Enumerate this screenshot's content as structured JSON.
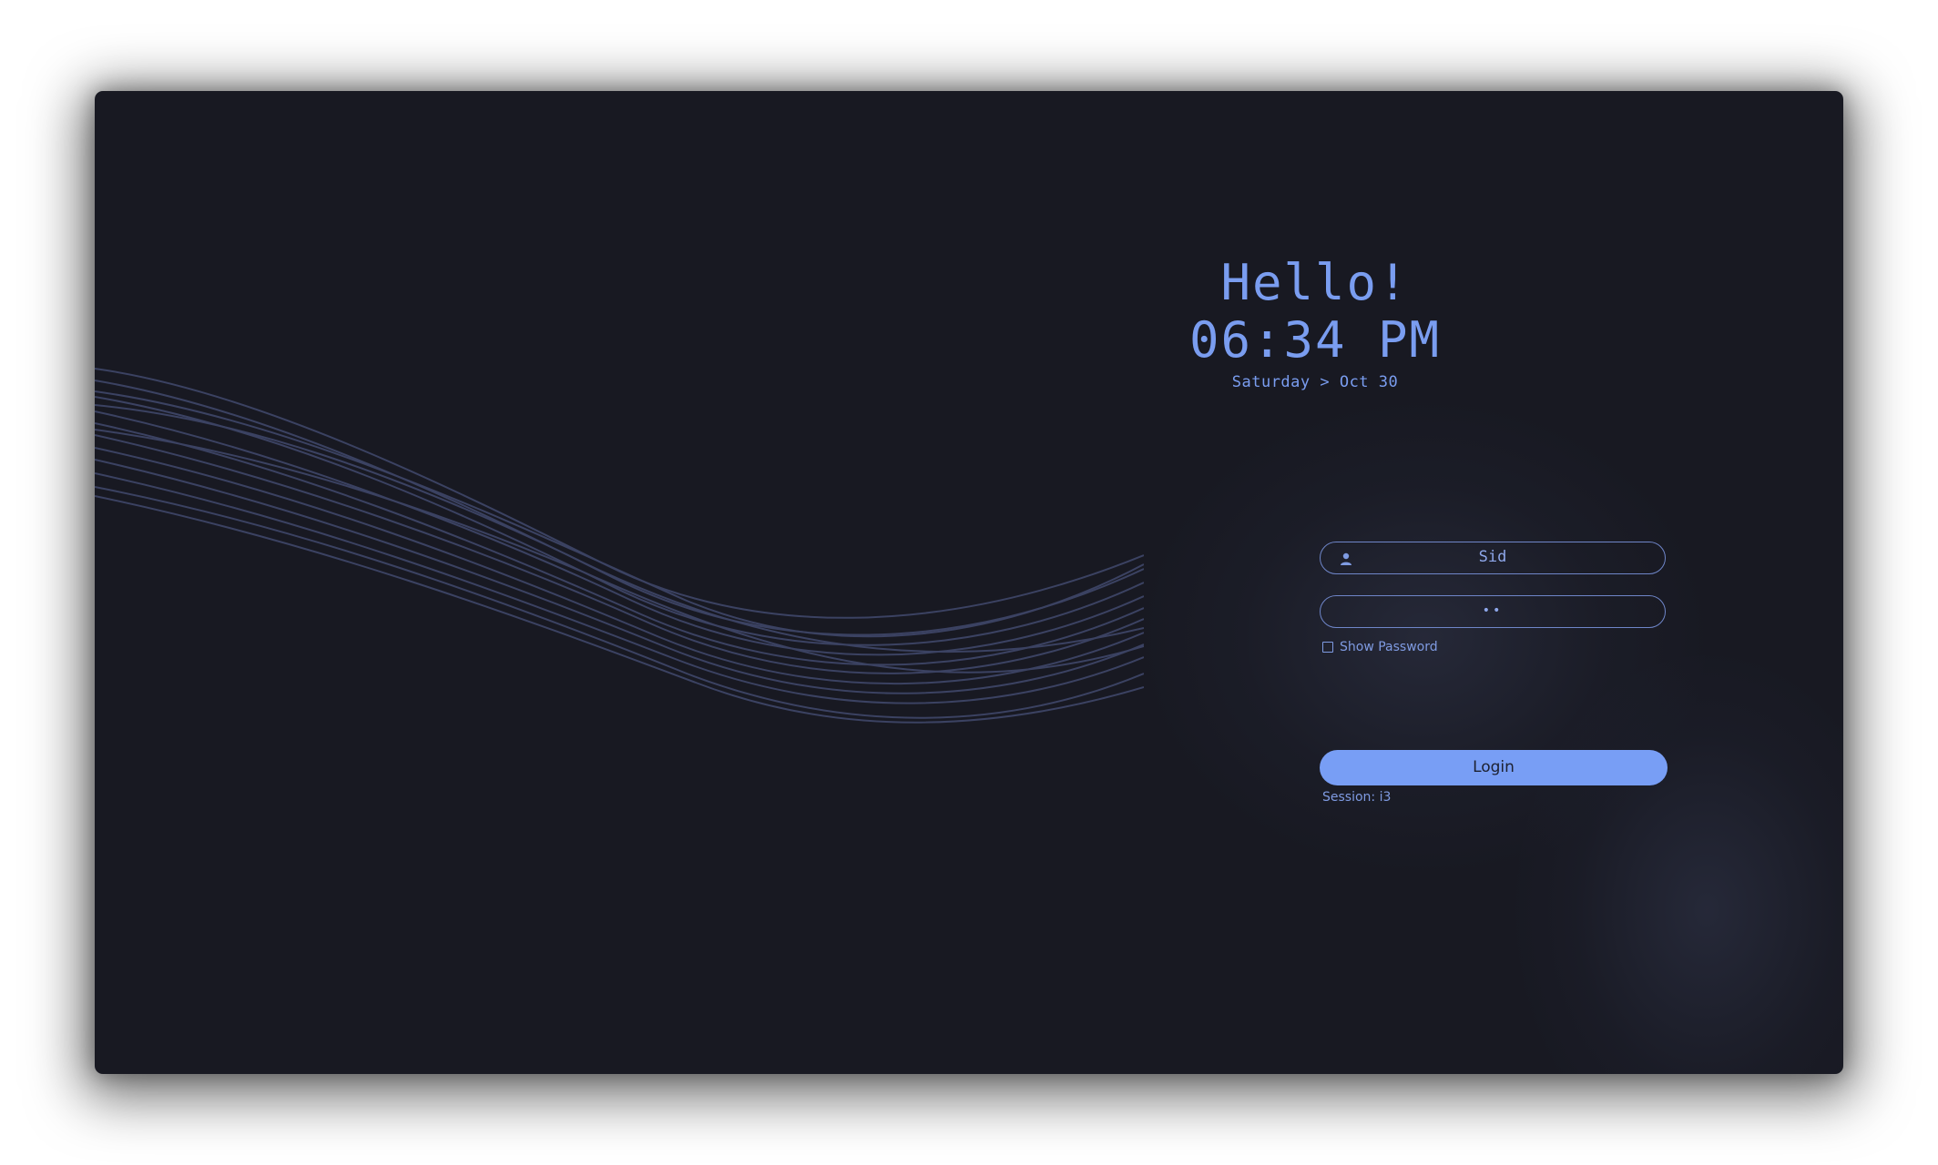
{
  "greeting": {
    "hello": "Hello!",
    "time": "06:34 PM",
    "date": "Saturday > Oct 30"
  },
  "form": {
    "username": "Sid",
    "password_mask": "••",
    "show_password_label": "Show Password",
    "login_label": "Login",
    "session_label": "Session: i3"
  },
  "icons": {
    "username_icon": "user-icon"
  },
  "colors": {
    "background": "#181922",
    "accent": "#789ef5",
    "text": "#7a9df0",
    "wave_lines": "#3b4262"
  }
}
